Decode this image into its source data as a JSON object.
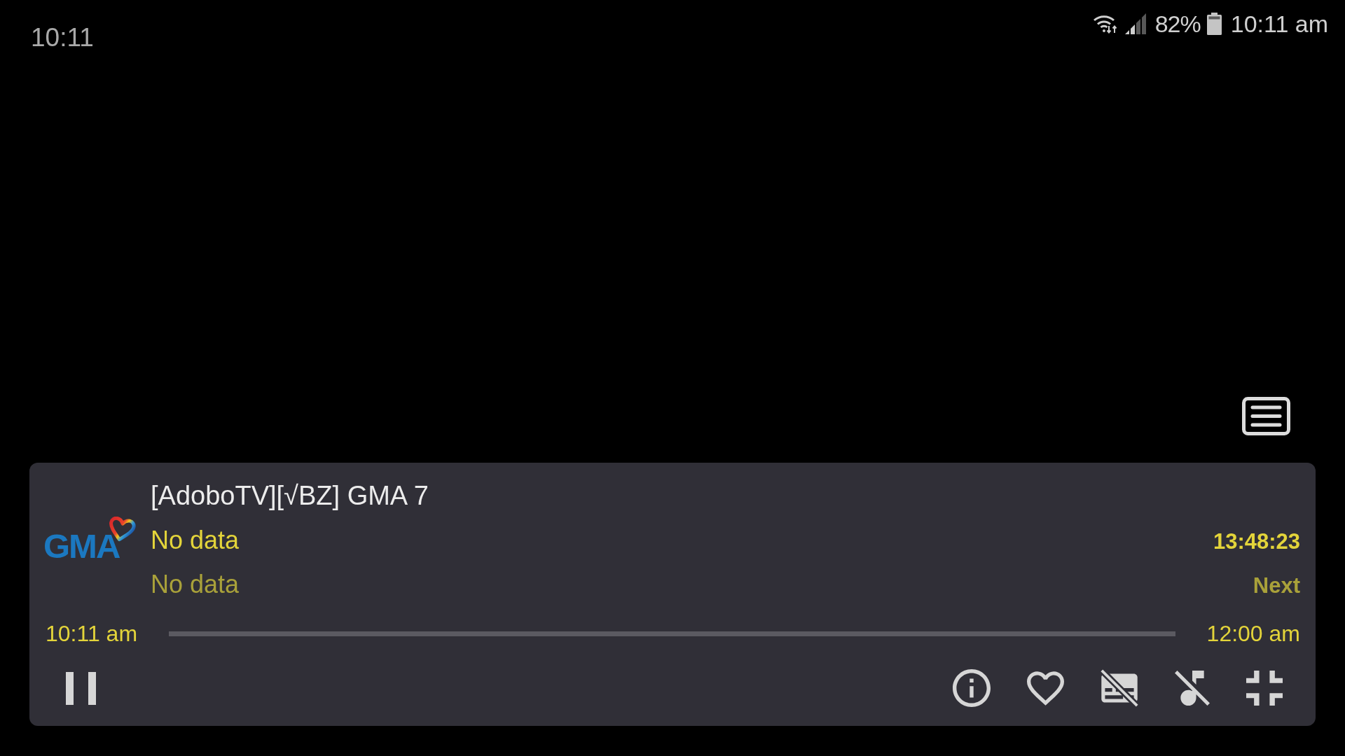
{
  "overlay_clock": "10:11",
  "status_bar": {
    "battery": "82%",
    "time": "10:11 am"
  },
  "channel": {
    "logo_text": "GMA",
    "title": "[AdoboTV][√BZ] GMA 7",
    "now": "No data",
    "countdown": "13:48:23",
    "next": "No data",
    "next_label": "Next"
  },
  "progress": {
    "start": "10:11 am",
    "level": 0,
    "end": "12:00 am"
  },
  "player": {
    "playing": true,
    "favorite": false,
    "subtitles": false,
    "audio": false
  }
}
